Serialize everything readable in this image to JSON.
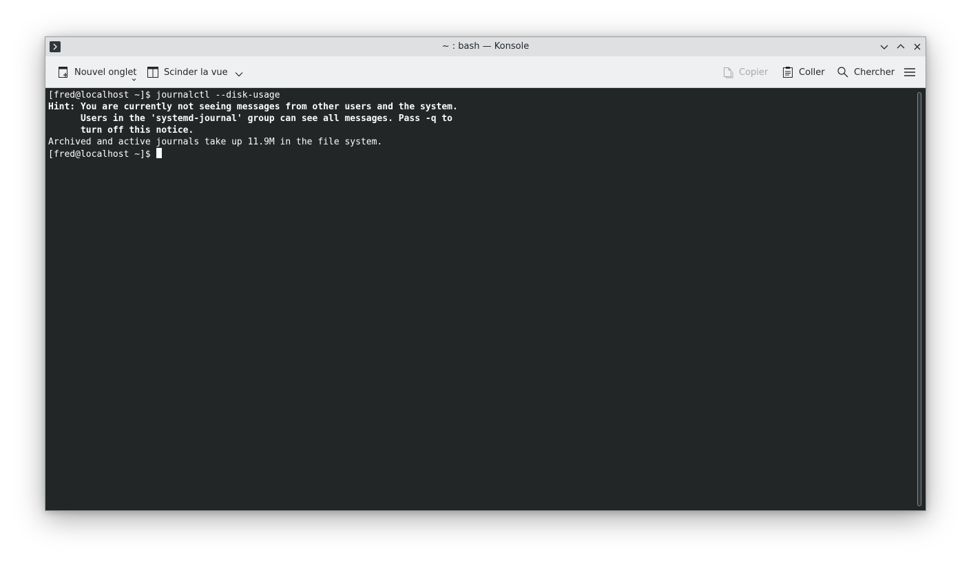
{
  "window": {
    "title": "~ : bash — Konsole"
  },
  "toolbar": {
    "new_tab_label": "Nouvel onglet",
    "split_view_label": "Scinder la vue",
    "copy_label": "Copier",
    "paste_label": "Coller",
    "search_label": "Chercher"
  },
  "terminal": {
    "lines": [
      {
        "text": "[fred@localhost ~]$ journalctl --disk-usage",
        "bold": false
      },
      {
        "text": "Hint: You are currently not seeing messages from other users and the system.",
        "bold": true
      },
      {
        "text": "      Users in the 'systemd-journal' group can see all messages. Pass -q to",
        "bold": true
      },
      {
        "text": "      turn off this notice.",
        "bold": true
      },
      {
        "text": "Archived and active journals take up 11.9M in the file system.",
        "bold": false
      }
    ],
    "prompt": "[fred@localhost ~]$ "
  },
  "icons": {
    "app": "konsole-app-icon",
    "new_tab": "new-tab-icon",
    "split_view": "split-view-icon",
    "copy": "copy-icon",
    "paste": "paste-icon",
    "search": "search-icon",
    "menu": "hamburger-menu-icon"
  },
  "colors": {
    "terminal_bg": "#232627",
    "terminal_fg": "#fcfcfc",
    "titlebar_bg": "#dee0e2",
    "toolbar_bg": "#eff0f1",
    "disabled_text": "#a6a8aa"
  }
}
